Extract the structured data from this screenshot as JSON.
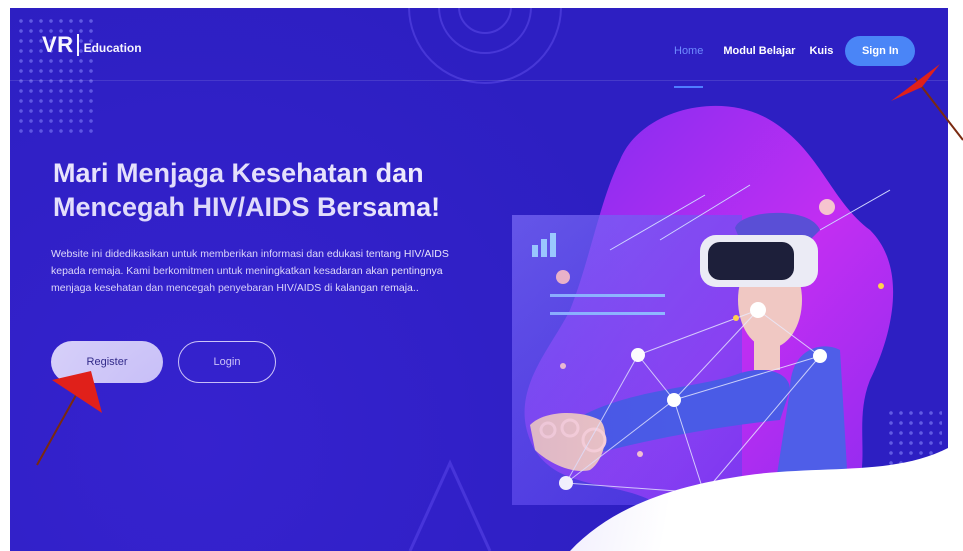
{
  "logo": {
    "mark": "VR",
    "text": "Education"
  },
  "nav": {
    "items": [
      {
        "label": "Home",
        "active": true
      },
      {
        "label": "Modul Belajar",
        "active": false
      },
      {
        "label": "Kuis",
        "active": false
      }
    ],
    "signin_label": "Sign In"
  },
  "hero": {
    "title": "Mari Menjaga Kesehatan dan Mencegah HIV/AIDS Bersama!",
    "description": "Website ini didedikasikan untuk memberikan informasi dan edukasi tentang HIV/AIDS kepada remaja. Kami berkomitmen untuk meningkatkan kesadaran akan pentingnya menjaga kesehatan dan mencegah penyebaran HIV/AIDS di kalangan remaja..",
    "register_label": "Register",
    "login_label": "Login"
  },
  "colors": {
    "background": "#2d1fc2",
    "accent": "#4a85f7",
    "blob": "#c02ff0",
    "annotation_arrow": "#e0201a"
  }
}
